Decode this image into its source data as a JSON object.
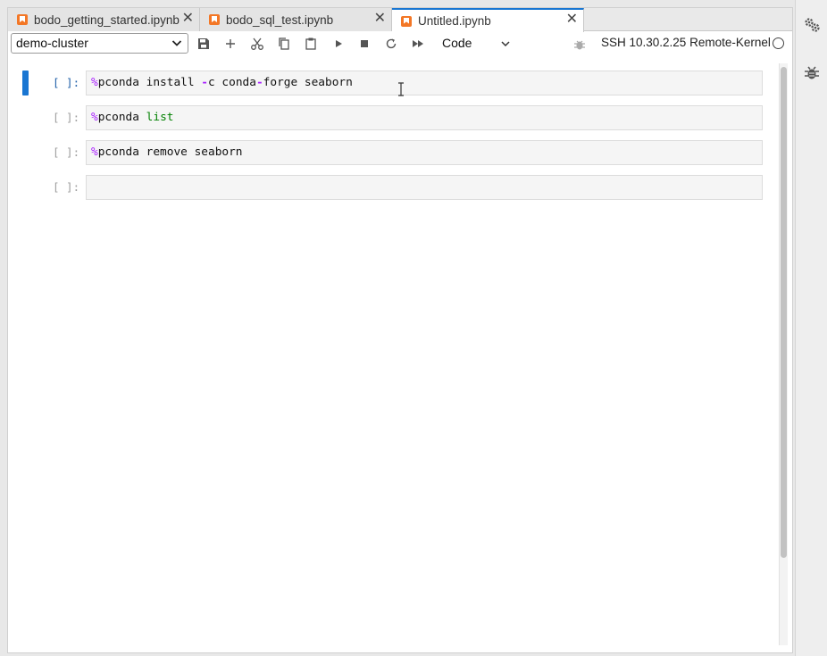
{
  "tabs": [
    {
      "label": "bodo_getting_started.ipynb",
      "active": false
    },
    {
      "label": "bodo_sql_test.ipynb",
      "active": false
    },
    {
      "label": "Untitled.ipynb",
      "active": true
    }
  ],
  "toolbar": {
    "cluster_selected": "demo-cluster",
    "cell_type": "Code",
    "kernel_label": "SSH 10.30.2.25 Remote-Kernel"
  },
  "cells": [
    {
      "prompt": "[ ]:",
      "active": true,
      "tokens": [
        {
          "t": "%",
          "c": "magic"
        },
        {
          "t": "pconda install ",
          "c": ""
        },
        {
          "t": "-",
          "c": "op"
        },
        {
          "t": "c conda",
          "c": ""
        },
        {
          "t": "-",
          "c": "op"
        },
        {
          "t": "forge seaborn",
          "c": ""
        }
      ]
    },
    {
      "prompt": "[ ]:",
      "active": false,
      "tokens": [
        {
          "t": "%",
          "c": "magic"
        },
        {
          "t": "pconda ",
          "c": ""
        },
        {
          "t": "list",
          "c": "kw"
        }
      ]
    },
    {
      "prompt": "[ ]:",
      "active": false,
      "tokens": [
        {
          "t": "%",
          "c": "magic"
        },
        {
          "t": "pconda remove seaborn",
          "c": ""
        }
      ]
    },
    {
      "prompt": "[ ]:",
      "active": false,
      "tokens": []
    }
  ],
  "icons": {
    "save": "save-icon",
    "add": "plus-icon",
    "cut": "scissors-icon",
    "copy": "copy-icon",
    "paste": "paste-icon",
    "run": "play-icon",
    "stop": "stop-icon",
    "restart": "refresh-icon",
    "run_all": "fast-forward-icon",
    "debug": "bug-icon",
    "settings": "gears-icon"
  },
  "colors": {
    "accent": "#1976d2",
    "notebook_icon": "#f37726",
    "magic": "#aa22ff",
    "keyword": "#008000"
  }
}
